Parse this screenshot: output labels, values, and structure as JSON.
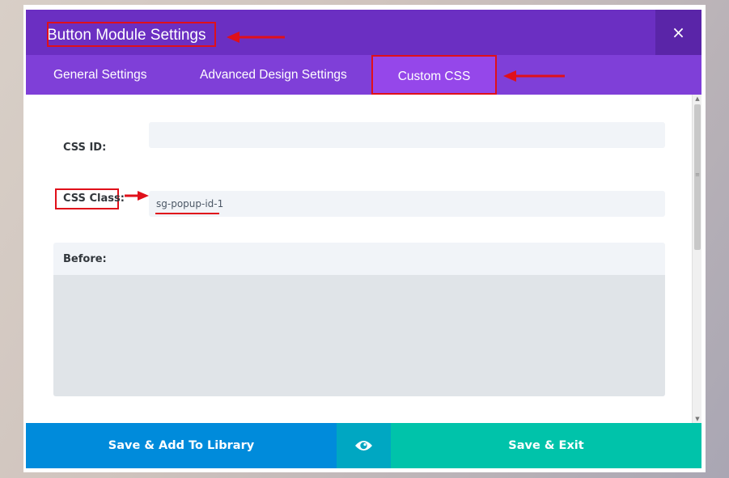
{
  "modal": {
    "title": "Button Module Settings",
    "close_label": "×"
  },
  "tabs": [
    {
      "label": "General Settings"
    },
    {
      "label": "Advanced Design Settings"
    },
    {
      "label": "Custom CSS",
      "active": true
    }
  ],
  "form": {
    "css_id_label": "CSS ID:",
    "css_id_value": "",
    "css_class_label": "CSS Class:",
    "css_class_value": "sg-popup-id-1",
    "before_label": "Before:",
    "before_value": ""
  },
  "footer": {
    "save_library_label": "Save & Add To Library",
    "preview_icon": "eye-icon",
    "save_exit_label": "Save & Exit"
  },
  "colors": {
    "header": "#6b2fc2",
    "tabs": "#7f3fd8",
    "active_tab": "#9547ea",
    "annotation": "#e0101a",
    "library_button": "#008bdb",
    "preview_button": "#00a7c2",
    "exit_button": "#00c3aa"
  }
}
